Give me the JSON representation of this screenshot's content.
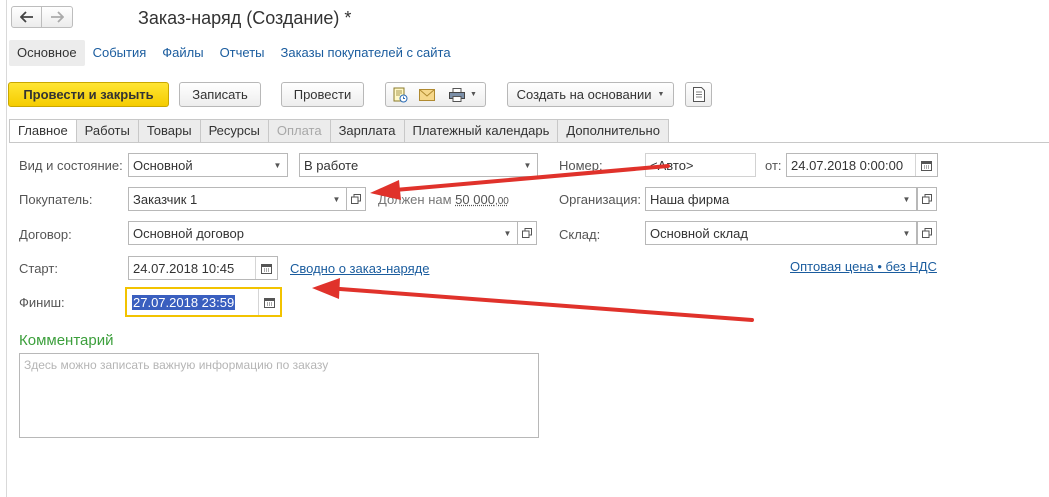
{
  "window": {
    "title": "Заказ-наряд (Создание) *"
  },
  "nav": {
    "back_icon": "arrow-left-icon",
    "forward_icon": "arrow-right-icon"
  },
  "sections": [
    "Основное",
    "События",
    "Файлы",
    "Отчеты",
    "Заказы покупателей с сайта"
  ],
  "toolbar": {
    "post_close": "Провести и закрыть",
    "save": "Записать",
    "post": "Провести",
    "create_based": "Создать на основании"
  },
  "tabs": [
    "Главное",
    "Работы",
    "Товары",
    "Ресурсы",
    "Оплата",
    "Зарплата",
    "Платежный календарь",
    "Дополнительно"
  ],
  "form": {
    "kind_label": "Вид и состояние:",
    "kind_value": "Основной",
    "state_value": "В работе",
    "number_label": "Номер:",
    "number_placeholder": "<Авто>",
    "date_label": "от:",
    "date_value": "24.07.2018  0:00:00",
    "buyer_label": "Покупатель:",
    "buyer_value": "Заказчик 1",
    "debt_text": "Должен нам",
    "debt_amount": "50 000",
    "debt_cents": ",00",
    "org_label": "Организация:",
    "org_value": "Наша фирма",
    "contract_label": "Договор:",
    "contract_value": "Основной договор",
    "warehouse_label": "Склад:",
    "warehouse_value": "Основной склад",
    "start_label": "Старт:",
    "start_value": "24.07.2018 10:45",
    "summary_link": "Сводно о заказ-наряде",
    "price_link": "Оптовая цена • без НДС",
    "finish_label": "Финиш:",
    "finish_value": "27.07.2018 23:59",
    "comment_title": "Комментарий",
    "comment_placeholder": "Здесь можно записать важную информацию по заказу"
  },
  "colors": {
    "primary_button": "#f5cc00",
    "link": "#1a5c9e",
    "arrow": "#e0322b",
    "comment_title": "#3c9f3c",
    "focus_border": "#f2c300"
  }
}
